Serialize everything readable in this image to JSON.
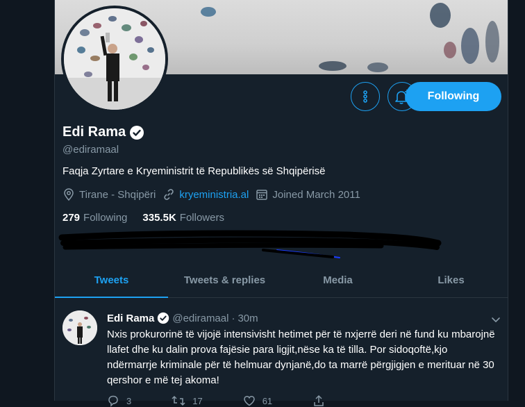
{
  "profile": {
    "name": "Edi Rama",
    "handle": "@ediramaal",
    "bio": "Faqja Zyrtare e Kryeministrit të Republikës së Shqipërisë",
    "location": "Tirane - Shqipëri",
    "website": "kryeministria.al",
    "joined": "Joined March 2011",
    "following_count": "279",
    "following_label": "Following",
    "followers_count": "335.5K",
    "followers_label": "Followers",
    "follow_button_label": "Following",
    "accent_color": "#1da1f2"
  },
  "tabs": [
    {
      "label": "Tweets"
    },
    {
      "label": "Tweets & replies"
    },
    {
      "label": "Media"
    },
    {
      "label": "Likes"
    }
  ],
  "tweet": {
    "name": "Edi Rama",
    "handle": "@ediramaal",
    "separator": "·",
    "time": "30m",
    "text": "Nxis prokurorinë të vijojë intensivisht hetimet për të nxjerrë deri në fund ku mbarojnë llafet dhe ku dalin prova fajësie para ligjit,nëse ka të tilla. Por sidoqoftë,kjo ndërmarrje kriminale për të helmuar dynjanë,do ta marrë përgjigjen e merituar në 30 qershor e më tej akoma!",
    "reply_count": "3",
    "retweet_count": "17",
    "like_count": "61"
  }
}
